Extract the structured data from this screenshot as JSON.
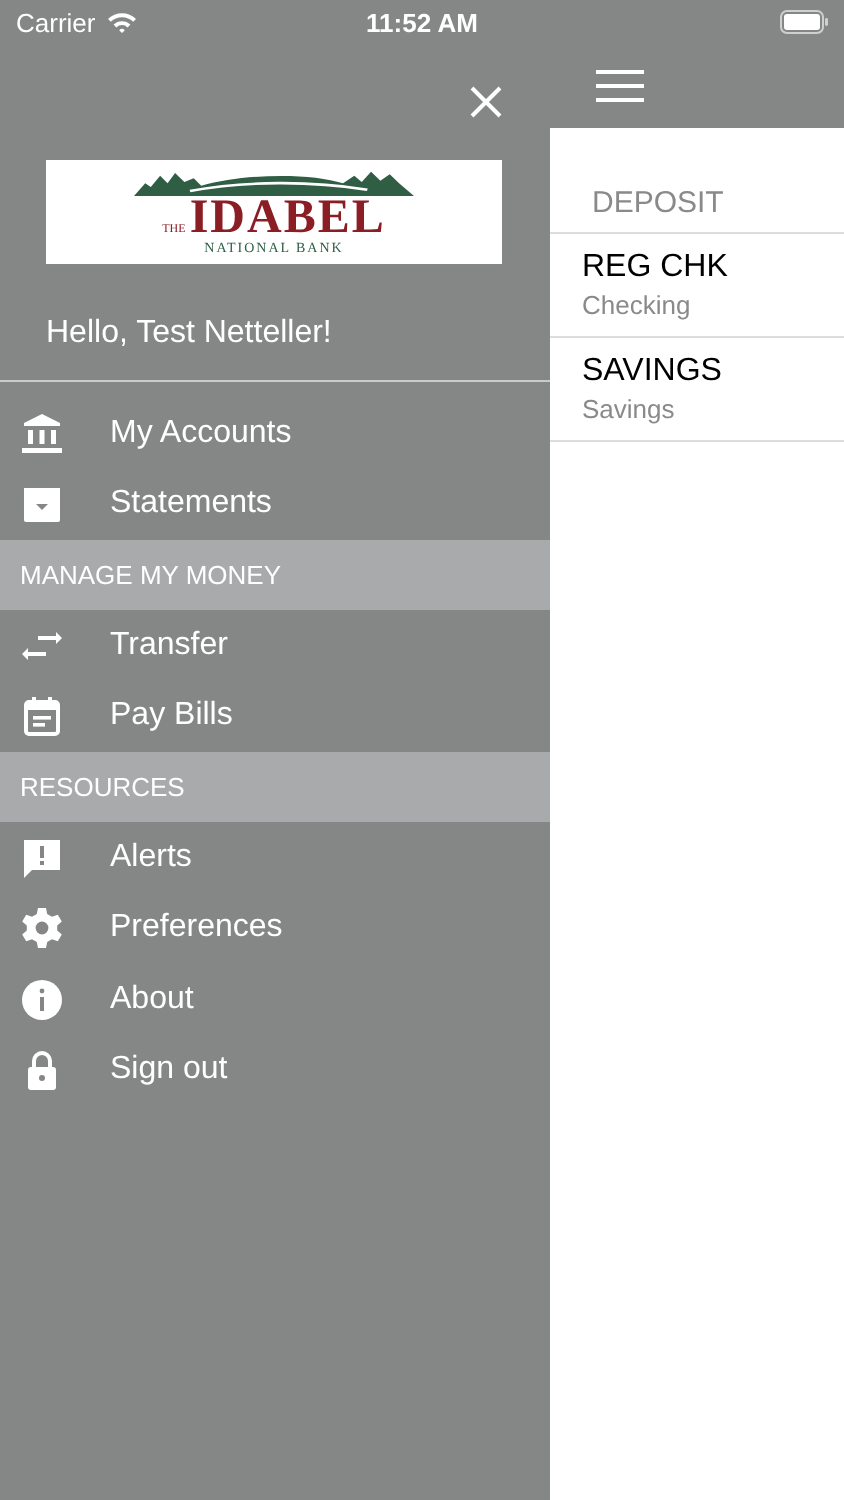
{
  "status_bar": {
    "carrier": "Carrier",
    "time": "11:52 AM"
  },
  "drawer": {
    "logo": {
      "small": "THE",
      "name": "IDABEL",
      "sub": "NATIONAL BANK"
    },
    "greeting": "Hello, Test Netteller!",
    "groups": [
      {
        "items": [
          {
            "kind": "bank",
            "label": "My Accounts"
          },
          {
            "kind": "statement",
            "label": "Statements"
          }
        ]
      },
      {
        "title": "MANAGE MY MONEY",
        "items": [
          {
            "kind": "transfer",
            "label": "Transfer"
          },
          {
            "kind": "calendar",
            "label": "Pay Bills"
          }
        ]
      },
      {
        "title": "RESOURCES",
        "items": [
          {
            "kind": "alert",
            "label": "Alerts"
          },
          {
            "kind": "gear",
            "label": "Preferences"
          },
          {
            "kind": "info",
            "label": "About"
          },
          {
            "kind": "lock",
            "label": "Sign out"
          }
        ]
      }
    ]
  },
  "accounts": {
    "section": "DEPOSIT",
    "rows": [
      {
        "name": "REG CHK",
        "type": "Checking"
      },
      {
        "name": "SAVINGS",
        "type": "Savings"
      }
    ]
  }
}
